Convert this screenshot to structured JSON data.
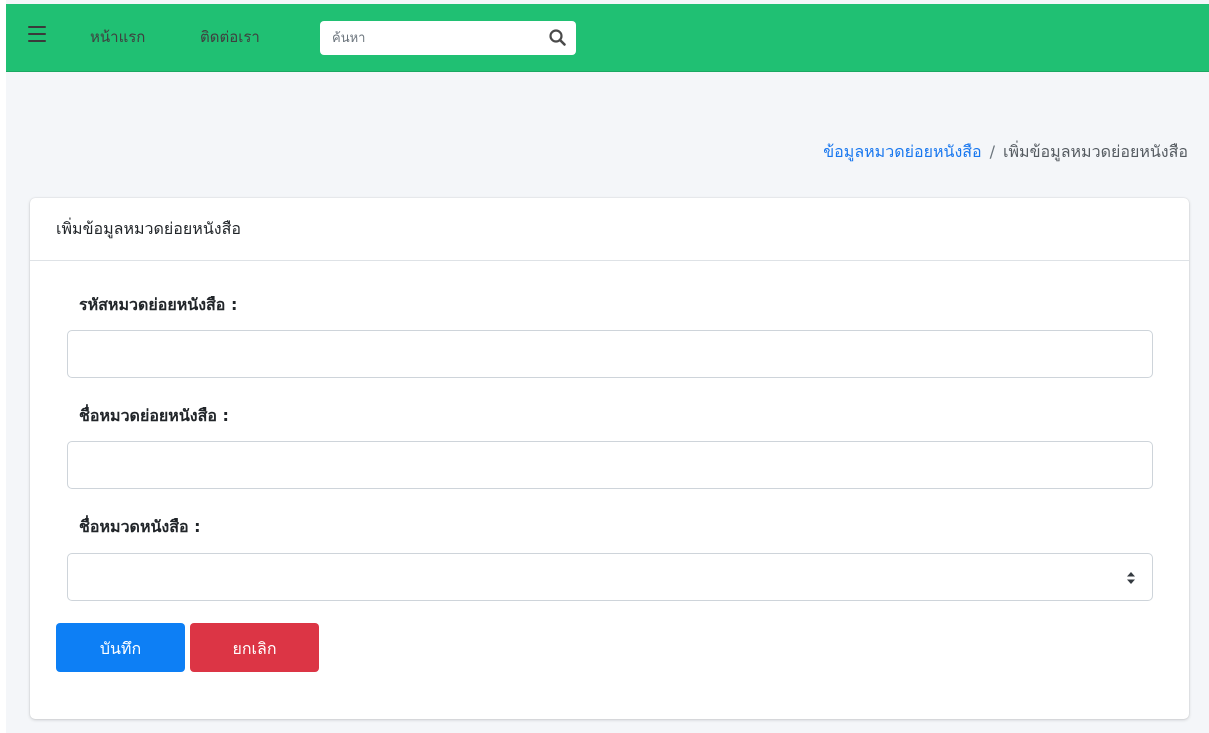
{
  "navbar": {
    "menu_icon": "hamburger-icon",
    "links": {
      "home": "หน้าแรก",
      "contact": "ติดต่อเรา"
    },
    "search": {
      "placeholder": "ค้นหา",
      "value": "",
      "icon": "search-icon"
    },
    "color": "#20c073"
  },
  "breadcrumb": {
    "parent": "ข้อมูลหมวดย่อยหนังสือ",
    "separator": "/",
    "current": "เพิ่มข้อมูลหมวดย่อยหนังสือ"
  },
  "card": {
    "title": "เพิ่มข้อมูลหมวดย่อยหนังสือ",
    "fields": {
      "subcategory_code": {
        "label": "รหัสหมวดย่อยหนังสือ :",
        "value": ""
      },
      "subcategory_name": {
        "label": "ชื่อหมวดย่อยหนังสือ :",
        "value": ""
      },
      "category_name": {
        "label": "ชื่อหมวดหนังสือ :",
        "selected": ""
      }
    },
    "buttons": {
      "save": "บันทึก",
      "cancel": "ยกเลิก"
    }
  },
  "colors": {
    "primary": "#0d7ff5",
    "danger": "#dc3545",
    "link": "#1877ef",
    "background": "#f4f6f9"
  }
}
